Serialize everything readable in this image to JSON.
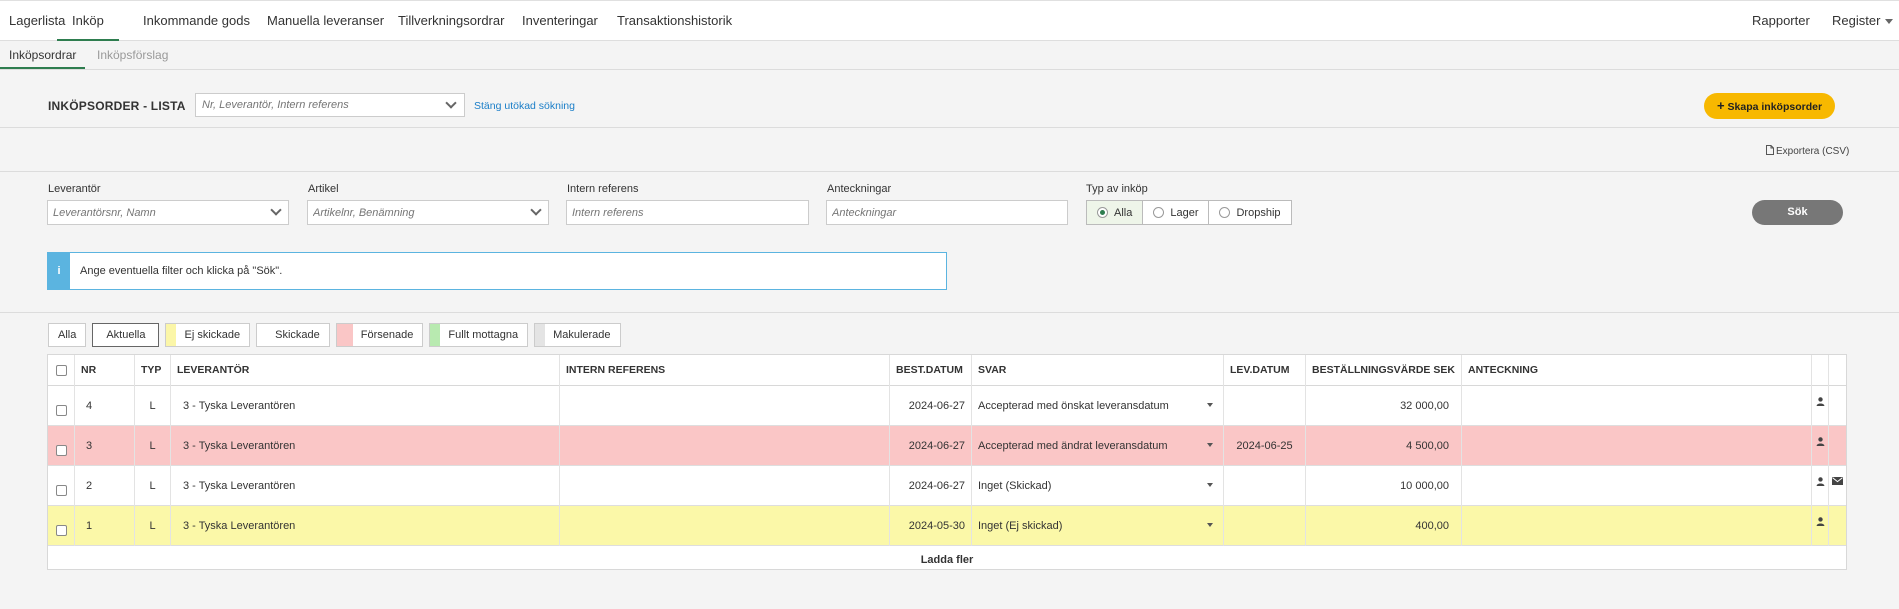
{
  "nav": {
    "tabs": [
      "Lagerlista",
      "Inköp",
      "Inkommande gods",
      "Manuella leveranser",
      "Tillverkningsordrar",
      "Inventeringar",
      "Transaktionshistorik"
    ],
    "active_tab": "Inköp",
    "reports": "Rapporter",
    "register": "Register"
  },
  "subnav": {
    "tabs": [
      "Inköpsordrar",
      "Inköpsförslag"
    ],
    "active_tab": "Inköpsordrar"
  },
  "header": {
    "title": "INKÖPSORDER - LISTA",
    "search_placeholder": "Nr, Leverantör, Intern referens",
    "toggle_search_link": "Stäng utökad sökning",
    "create_button": "Skapa inköpsorder",
    "export_link": "Exportera (CSV)"
  },
  "filters": {
    "supplier": {
      "label": "Leverantör",
      "placeholder": "Leverantörsnr, Namn"
    },
    "article": {
      "label": "Artikel",
      "placeholder": "Artikelnr, Benämning"
    },
    "internal_ref": {
      "label": "Intern referens",
      "placeholder": "Intern referens"
    },
    "notes": {
      "label": "Anteckningar",
      "placeholder": "Anteckningar"
    },
    "purchase_type": {
      "label": "Typ av inköp",
      "options": [
        "Alla",
        "Lager",
        "Dropship"
      ],
      "selected": "Alla"
    },
    "search_button": "Sök"
  },
  "info_message": "Ange eventuella filter och klicka på \"Sök\".",
  "status_filters": [
    {
      "label": "Alla",
      "color": ""
    },
    {
      "label": "Aktuella",
      "color": "",
      "active": true
    },
    {
      "label": "Ej skickade",
      "color": "#fbf6a8"
    },
    {
      "label": "Skickade",
      "color": "#ffffff"
    },
    {
      "label": "Försenade",
      "color": "#fac6c6"
    },
    {
      "label": "Fullt mottagna",
      "color": "#b8eab0"
    },
    {
      "label": "Makulerade",
      "color": "#e4e4e4"
    }
  ],
  "table": {
    "columns": [
      "NR",
      "TYP",
      "LEVERANTÖR",
      "INTERN REFERENS",
      "BEST.DATUM",
      "SVAR",
      "LEV.DATUM",
      "BESTÄLLNINGSVÄRDE SEK",
      "ANTECKNING"
    ],
    "rows": [
      {
        "nr": "4",
        "typ": "L",
        "supplier": "3 - Tyska Leverantören",
        "ref": "",
        "date": "2024-06-27",
        "answer": "Accepterad med önskat leveransdatum",
        "lev_date": "",
        "value": "32 000,00",
        "note": "",
        "row_color": "#ffffff",
        "mail": false
      },
      {
        "nr": "3",
        "typ": "L",
        "supplier": "3 - Tyska Leverantören",
        "ref": "",
        "date": "2024-06-27",
        "answer": "Accepterad med ändrat leveransdatum",
        "lev_date": "2024-06-25",
        "value": "4 500,00",
        "note": "",
        "row_color": "#fac6c6",
        "mail": false
      },
      {
        "nr": "2",
        "typ": "L",
        "supplier": "3 - Tyska Leverantören",
        "ref": "",
        "date": "2024-06-27",
        "answer": "Inget (Skickad)",
        "lev_date": "",
        "value": "10 000,00",
        "note": "",
        "row_color": "#ffffff",
        "mail": true
      },
      {
        "nr": "1",
        "typ": "L",
        "supplier": "3 - Tyska Leverantören",
        "ref": "",
        "date": "2024-05-30",
        "answer": "Inget (Ej skickad)",
        "lev_date": "",
        "value": "400,00",
        "note": "",
        "row_color": "#fbf8a8",
        "mail": false
      }
    ],
    "load_more": "Ladda fler"
  },
  "icons": {
    "person": "user-icon",
    "mail": "envelope-icon",
    "info": "info-icon",
    "plus": "plus-icon",
    "document": "document-icon"
  },
  "colors": {
    "accent_green": "#2e7d4f",
    "create_button": "#f7b800",
    "info_blue": "#5bb4e0",
    "link_blue": "#1a7ec8"
  }
}
